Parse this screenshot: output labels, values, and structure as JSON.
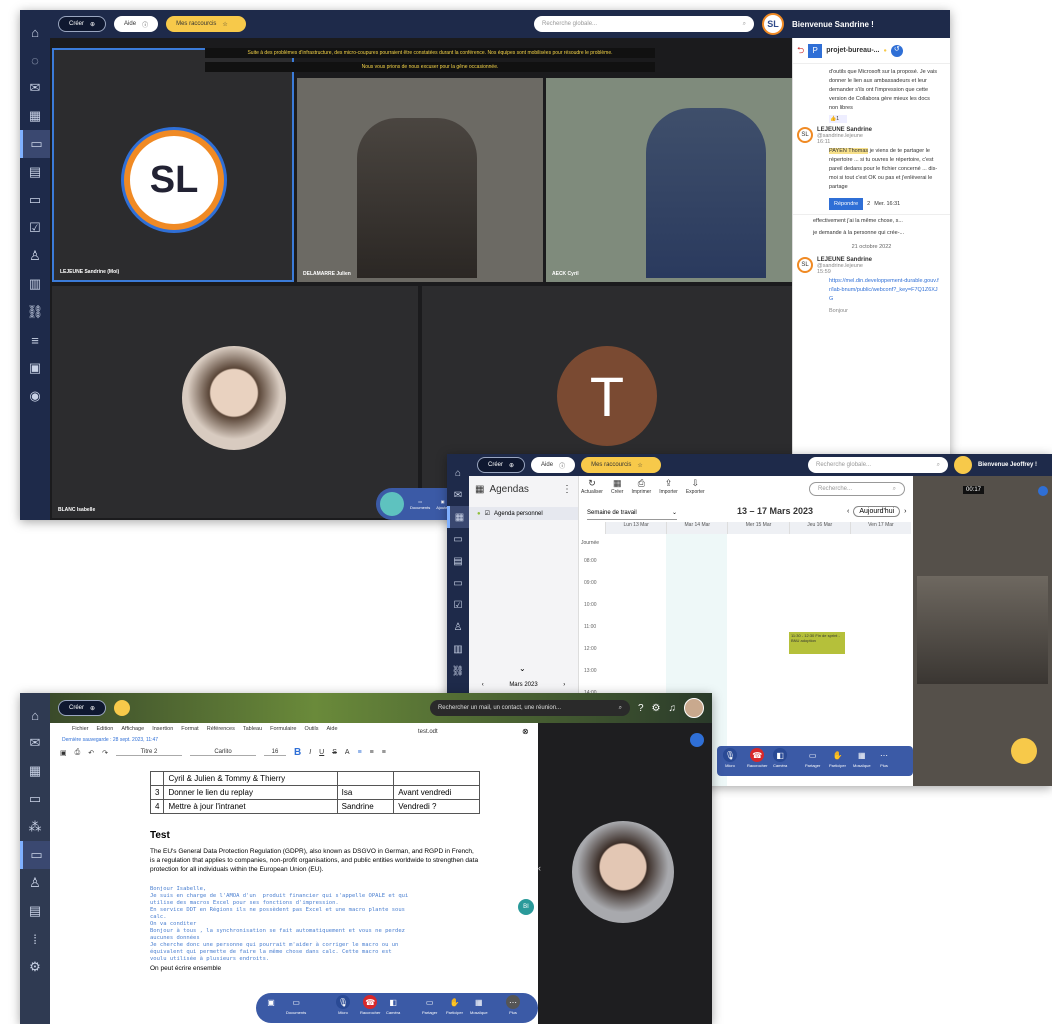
{
  "colors": {
    "navy": "#1e2a4a",
    "accent": "#f7c94a",
    "brand_orange": "#f08a24",
    "brand_blue": "#2f6fd6",
    "doc_bar": "#3b5aa6"
  },
  "win1": {
    "create_label": "Créer",
    "help_label": "Aide",
    "shortcuts_label": "Mes raccourcis",
    "search_placeholder": "Recherche globale...",
    "avatar_initials": "SL",
    "welcome": "Bienvenue Sandrine !",
    "banner1": "Suite à des problèmes d'infrastructure, des micro-coupures pourraient être constatées durant la conférence. Nos équipes sont mobilisées pour résoudre le problème.",
    "banner2": "Nous vous prions de nous excuser pour la gêne occasionnée.",
    "logo_text": "SL",
    "tiles": [
      "LEJEUNE Sandrine (Moi)",
      "DELAMARRE Julien",
      "AECK Cyril",
      "BLANC Isabelle"
    ],
    "t_initial": "T",
    "dock": [
      "Documents",
      "Ajouter"
    ],
    "chat": {
      "channel": "projet-bureau-...",
      "msg1": "d'outils que Microsoft sur la proposé. Je vais donner le lien aux ambassadeurs et leur demander s'ils ont l'impression que cette version de Collabora gère mieux les docs non libres",
      "reaction": "👍1",
      "author": "LEJEUNE Sandrine",
      "handle": "@sandrine.lejeune",
      "time": "16:11",
      "mention": "PAYEN Thomas",
      "msg2": "je viens de te partager le répertoire ... si tu ouvres le répertoire, c'est pareil dedans pour le fichier concerné ... dis-moi si tout c'est OK ou pas et j'enlèverai le partage",
      "reply_btn": "Répondre",
      "reply_count": "2",
      "reply_time": "Mer. 16:31",
      "thread1": "effectivement j'ai la même chose, s...",
      "thread2": "je demande à la personne qui crée-...",
      "date_sep": "21 octobre 2022",
      "author2": "LEJEUNE Sandrine",
      "handle2": "@sandrine.lejeune",
      "time2": "15:59",
      "link": "https://mel.din.developpement-durable.gouv.fr/lab-bnum/public/webconf?_key=F7Q1Z6XJG",
      "cut": "Bonjour"
    }
  },
  "win2": {
    "create_label": "Créer",
    "help_label": "Aide",
    "shortcuts_label": "Mes raccourcis",
    "search_placeholder": "Recherche globale...",
    "welcome": "Bienvenue Jeoffrey !",
    "agendas_title": "Agendas",
    "agenda_item": "Agenda personnel",
    "toolbar": [
      "Actualiser",
      "Créer",
      "Imprimer",
      "Importer",
      "Exporter"
    ],
    "view_select": "Semaine de travail",
    "range": "13 – 17 Mars 2023",
    "cal_search": "Recherche...",
    "today": "Aujourd'hui",
    "days": [
      "Lun 13 Mar",
      "Mar 14 Mar",
      "Mer 15 Mar",
      "Jeu 16 Mar",
      "Ven 17 Mar"
    ],
    "allday": "Journée",
    "hours": [
      "08:00",
      "09:00",
      "10:00",
      "11:00",
      "12:00",
      "13:00",
      "14:00"
    ],
    "event": "11:30 - 12:30 Fin de sprint - BNU adoption",
    "mini_month": "Mars 2023",
    "timer": "00:17",
    "controls": [
      "Micro",
      "Raccrocher",
      "Caméra",
      "Partager",
      "Participer",
      "Mosaïque",
      "Plus"
    ]
  },
  "win3": {
    "create_label": "Créer",
    "search_placeholder": "Rechercher un mail, un contact, une réunion...",
    "menu": [
      "Fichier",
      "Edition",
      "Affichage",
      "Insertion",
      "Format",
      "Références",
      "Tableau",
      "Formulaire",
      "Outils",
      "Aide"
    ],
    "saved": "Dernière sauvegarde : 28 sept. 2023, 11:47",
    "doc_name": "test.odt",
    "style": "Titre 2",
    "font": "Carlito",
    "size": "16",
    "table_rows": [
      [
        "",
        "Cyril & Julien & Tommy & Thierry",
        ""
      ],
      [
        "3",
        "Donner le lien du replay",
        "Isa",
        "Avant vendredi"
      ],
      [
        "4",
        "Mettre à jour l'intranet",
        "Sandrine",
        "Vendredi ?"
      ]
    ],
    "heading": "Test",
    "para": "The EU's General Data Protection Regulation (GDPR), also known as DSGVO in German, and RGPD in French, is a regulation that applies to companies, non-profit organisations, and public entities worldwide to strengthen data protection for all individuals within the European Union (EU).",
    "mono": "Bonjour Isabelle,\nJe suis en charge de l'AMOA d'un  produit financier qui s'appelle OPALE et qui\nutilise des macros Excel pour ses fonctions d'impression.\nEn service DDT en Régions ils ne possèdent pas Excel et une macro plante sous\ncalc.\nOn va conditer\nBonjour à tous , la synchronisation se fait automatiquement et vous ne perdez\naucunes données\nJe cherche donc une personne qui pourrait m'aider à corriger le macro ou un\néquivalent qui permette de faire la même chose dans calc. Cette macro est\nvoulu utilisée à plusieurs endroits.",
    "last_line": "On peut écrire ensemble",
    "bubble": "BI",
    "controls": [
      "Documents",
      "Micro",
      "Raccrocher",
      "Caméra",
      "Partager",
      "Participer",
      "Mosaïque",
      "Plus"
    ]
  }
}
